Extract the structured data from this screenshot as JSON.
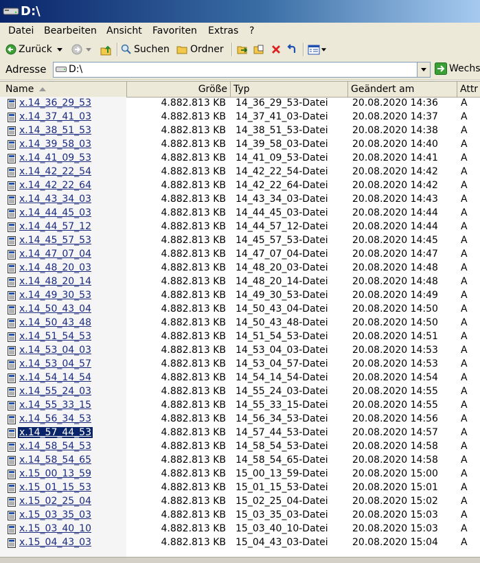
{
  "window": {
    "title": "D:\\"
  },
  "menu": [
    "Datei",
    "Bearbeiten",
    "Ansicht",
    "Favoriten",
    "Extras",
    "?"
  ],
  "toolbar": {
    "back_label": "Zurück",
    "search_label": "Suchen",
    "folders_label": "Ordner"
  },
  "address": {
    "label": "Adresse",
    "value": "D:\\",
    "go_label": "Wechs"
  },
  "columns": {
    "name": "Name",
    "size": "Größe",
    "type": "Typ",
    "modified": "Geändert am",
    "attr": "Attr"
  },
  "selected_index": 24,
  "files": [
    {
      "name": "x.14_36_29_53",
      "size": "4.882.813 KB",
      "type": "14_36_29_53-Datei",
      "modified": "20.08.2020 14:36",
      "attr": "A"
    },
    {
      "name": "x.14_37_41_03",
      "size": "4.882.813 KB",
      "type": "14_37_41_03-Datei",
      "modified": "20.08.2020 14:37",
      "attr": "A"
    },
    {
      "name": "x.14_38_51_53",
      "size": "4.882.813 KB",
      "type": "14_38_51_53-Datei",
      "modified": "20.08.2020 14:38",
      "attr": "A"
    },
    {
      "name": "x.14_39_58_03",
      "size": "4.882.813 KB",
      "type": "14_39_58_03-Datei",
      "modified": "20.08.2020 14:40",
      "attr": "A"
    },
    {
      "name": "x.14_41_09_53",
      "size": "4.882.813 KB",
      "type": "14_41_09_53-Datei",
      "modified": "20.08.2020 14:41",
      "attr": "A"
    },
    {
      "name": "x.14_42_22_54",
      "size": "4.882.813 KB",
      "type": "14_42_22_54-Datei",
      "modified": "20.08.2020 14:42",
      "attr": "A"
    },
    {
      "name": "x.14_42_22_64",
      "size": "4.882.813 KB",
      "type": "14_42_22_64-Datei",
      "modified": "20.08.2020 14:42",
      "attr": "A"
    },
    {
      "name": "x.14_43_34_03",
      "size": "4.882.813 KB",
      "type": "14_43_34_03-Datei",
      "modified": "20.08.2020 14:43",
      "attr": "A"
    },
    {
      "name": "x.14_44_45_03",
      "size": "4.882.813 KB",
      "type": "14_44_45_03-Datei",
      "modified": "20.08.2020 14:44",
      "attr": "A"
    },
    {
      "name": "x.14_44_57_12",
      "size": "4.882.813 KB",
      "type": "14_44_57_12-Datei",
      "modified": "20.08.2020 14:44",
      "attr": "A"
    },
    {
      "name": "x.14_45_57_53",
      "size": "4.882.813 KB",
      "type": "14_45_57_53-Datei",
      "modified": "20.08.2020 14:45",
      "attr": "A"
    },
    {
      "name": "x.14_47_07_04",
      "size": "4.882.813 KB",
      "type": "14_47_07_04-Datei",
      "modified": "20.08.2020 14:47",
      "attr": "A"
    },
    {
      "name": "x.14_48_20_03",
      "size": "4.882.813 KB",
      "type": "14_48_20_03-Datei",
      "modified": "20.08.2020 14:48",
      "attr": "A"
    },
    {
      "name": "x.14_48_20_14",
      "size": "4.882.813 KB",
      "type": "14_48_20_14-Datei",
      "modified": "20.08.2020 14:48",
      "attr": "A"
    },
    {
      "name": "x.14_49_30_53",
      "size": "4.882.813 KB",
      "type": "14_49_30_53-Datei",
      "modified": "20.08.2020 14:49",
      "attr": "A"
    },
    {
      "name": "x.14_50_43_04",
      "size": "4.882.813 KB",
      "type": "14_50_43_04-Datei",
      "modified": "20.08.2020 14:50",
      "attr": "A"
    },
    {
      "name": "x.14_50_43_48",
      "size": "4.882.813 KB",
      "type": "14_50_43_48-Datei",
      "modified": "20.08.2020 14:50",
      "attr": "A"
    },
    {
      "name": "x.14_51_54_53",
      "size": "4.882.813 KB",
      "type": "14_51_54_53-Datei",
      "modified": "20.08.2020 14:51",
      "attr": "A"
    },
    {
      "name": "x.14_53_04_03",
      "size": "4.882.813 KB",
      "type": "14_53_04_03-Datei",
      "modified": "20.08.2020 14:53",
      "attr": "A"
    },
    {
      "name": "x.14_53_04_57",
      "size": "4.882.813 KB",
      "type": "14_53_04_57-Datei",
      "modified": "20.08.2020 14:53",
      "attr": "A"
    },
    {
      "name": "x.14_54_14_54",
      "size": "4.882.813 KB",
      "type": "14_54_14_54-Datei",
      "modified": "20.08.2020 14:54",
      "attr": "A"
    },
    {
      "name": "x.14_55_24_03",
      "size": "4.882.813 KB",
      "type": "14_55_24_03-Datei",
      "modified": "20.08.2020 14:55",
      "attr": "A"
    },
    {
      "name": "x.14_55_33_15",
      "size": "4.882.813 KB",
      "type": "14_55_33_15-Datei",
      "modified": "20.08.2020 14:55",
      "attr": "A"
    },
    {
      "name": "x.14_56_34_53",
      "size": "4.882.813 KB",
      "type": "14_56_34_53-Datei",
      "modified": "20.08.2020 14:56",
      "attr": "A"
    },
    {
      "name": "x.14_57_44_53",
      "size": "4.882.813 KB",
      "type": "14_57_44_53-Datei",
      "modified": "20.08.2020 14:57",
      "attr": "A"
    },
    {
      "name": "x.14_58_54_53",
      "size": "4.882.813 KB",
      "type": "14_58_54_53-Datei",
      "modified": "20.08.2020 14:58",
      "attr": "A"
    },
    {
      "name": "x.14_58_54_65",
      "size": "4.882.813 KB",
      "type": "14_58_54_65-Datei",
      "modified": "20.08.2020 14:58",
      "attr": "A"
    },
    {
      "name": "x.15_00_13_59",
      "size": "4.882.813 KB",
      "type": "15_00_13_59-Datei",
      "modified": "20.08.2020 15:00",
      "attr": "A"
    },
    {
      "name": "x.15_01_15_53",
      "size": "4.882.813 KB",
      "type": "15_01_15_53-Datei",
      "modified": "20.08.2020 15:01",
      "attr": "A"
    },
    {
      "name": "x.15_02_25_04",
      "size": "4.882.813 KB",
      "type": "15_02_25_04-Datei",
      "modified": "20.08.2020 15:02",
      "attr": "A"
    },
    {
      "name": "x.15_03_35_03",
      "size": "4.882.813 KB",
      "type": "15_03_35_03-Datei",
      "modified": "20.08.2020 15:03",
      "attr": "A"
    },
    {
      "name": "x.15_03_40_10",
      "size": "4.882.813 KB",
      "type": "15_03_40_10-Datei",
      "modified": "20.08.2020 15:03",
      "attr": "A"
    },
    {
      "name": "x.15_04_43_03",
      "size": "4.882.813 KB",
      "type": "15_04_43_03-Datei",
      "modified": "20.08.2020 15:04",
      "attr": "A"
    }
  ],
  "colors": {
    "titlebar_start": "#0a246a",
    "titlebar_end": "#a6caf0",
    "chrome": "#ece9d8",
    "selection": "#0a246a",
    "link_text": "#1a2a80"
  }
}
